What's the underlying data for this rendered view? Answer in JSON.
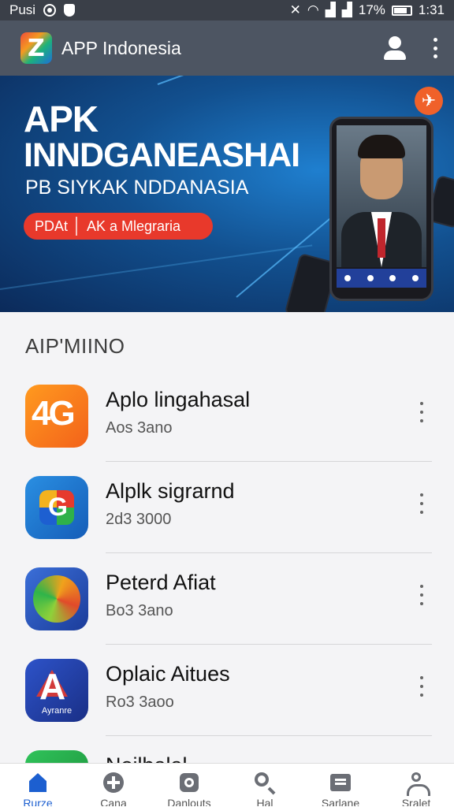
{
  "status_bar": {
    "carrier": "Pusi",
    "battery_percent": "17%",
    "time": "1:31"
  },
  "app_bar": {
    "title": "APP Indonesia",
    "account_icon": "account-icon",
    "more_icon": "more-vert-icon"
  },
  "hero": {
    "title_line1": "APK",
    "title_line2": "INNDGANEASHAI",
    "subtitle": "PB SIYKAK NDDANASIA",
    "pill_left": "PDAt",
    "pill_right": "AK a Mlegraria",
    "accent_color": "#e8392b"
  },
  "section": {
    "title": "AIP'MIINO"
  },
  "apps": [
    {
      "name": "Aplo lingahasal",
      "sub": "Aos 3ano",
      "icon": "app-icon-4g",
      "glyph": "4G"
    },
    {
      "name": "Alplk sigrarnd",
      "sub": "2d3 3000",
      "icon": "app-icon-g"
    },
    {
      "name": "Peterd Afiat",
      "sub": "Bo3 3ano",
      "icon": "app-icon-disc"
    },
    {
      "name": "Oplaic Aitues",
      "sub": "Ro3 3aoo",
      "icon": "app-icon-a",
      "glyph": "A",
      "caption": "Ayranre"
    },
    {
      "name": "Noilbalal",
      "sub": "",
      "icon": "app-icon-green"
    }
  ],
  "bottom_nav": [
    {
      "label": "Rurze",
      "icon": "home-icon",
      "active": true
    },
    {
      "label": "Cana",
      "icon": "add-circle-icon",
      "active": false
    },
    {
      "label": "Danlouts",
      "icon": "download-icon",
      "active": false
    },
    {
      "label": "Hal",
      "icon": "search-icon",
      "active": false
    },
    {
      "label": "Sarlane",
      "icon": "cards-icon",
      "active": false
    },
    {
      "label": "Sralet",
      "icon": "person-icon",
      "active": false
    }
  ],
  "colors": {
    "app_bar": "#4d5562",
    "nav_active": "#1c5fd0"
  }
}
